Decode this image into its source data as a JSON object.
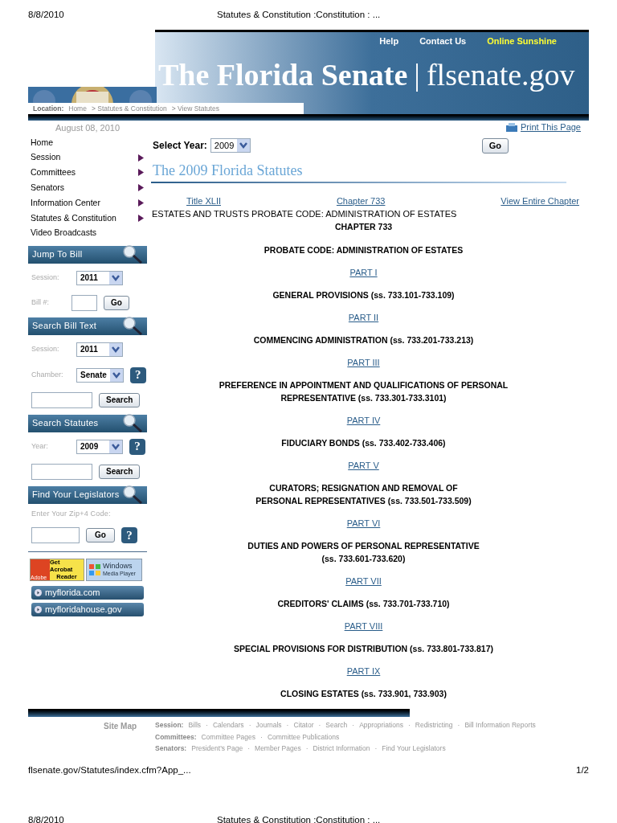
{
  "print_header": {
    "date": "8/8/2010",
    "title": "Statutes & Constitution :Constitution : ..."
  },
  "banner": {
    "nav_links": [
      {
        "label": "Help",
        "highlight": false
      },
      {
        "label": "Contact Us",
        "highlight": false
      },
      {
        "label": "Online Sunshine",
        "highlight": true
      }
    ],
    "title": "The Florida Senate",
    "separator": "|",
    "domain": "flsenate.gov",
    "location": {
      "label": "Location:",
      "crumbs": [
        "Home",
        "> Statutes & Constitution",
        "> View Statutes"
      ]
    }
  },
  "date": "August 08, 2010",
  "print_link": "Print This Page",
  "sidebar": {
    "menu": [
      {
        "label": "Home",
        "has_submenu": false
      },
      {
        "label": "Session",
        "has_submenu": true
      },
      {
        "label": "Committees",
        "has_submenu": true
      },
      {
        "label": "Senators",
        "has_submenu": true
      },
      {
        "label": "Information Center",
        "has_submenu": true
      },
      {
        "label": "Statutes & Constitution",
        "has_submenu": true
      },
      {
        "label": "Video Broadcasts",
        "has_submenu": false
      }
    ],
    "widgets": [
      {
        "title": "Jump To Bill",
        "rows": [
          {
            "kind": "select",
            "label": "Session:",
            "value": "2011"
          },
          {
            "kind": "input",
            "label": "Bill #:",
            "button": "Go"
          }
        ]
      },
      {
        "title": "Search Bill Text",
        "rows": [
          {
            "kind": "select",
            "label": "Session:",
            "value": "2011"
          },
          {
            "kind": "select",
            "label": "Chamber:",
            "value": "Senate",
            "help": "?"
          },
          {
            "kind": "input",
            "button": "Search"
          }
        ]
      },
      {
        "title": "Search Statutes",
        "rows": [
          {
            "kind": "select",
            "label": "Year:",
            "value": "2009",
            "help": "?"
          },
          {
            "kind": "input",
            "button": "Search"
          }
        ]
      },
      {
        "title": "Find Your Legislators",
        "rows": [
          {
            "kind": "note",
            "label": "Enter Your Zip+4 Code:"
          },
          {
            "kind": "input",
            "button": "Go",
            "help": "?"
          }
        ]
      }
    ],
    "badges": {
      "acrobat": {
        "brand": "Adobe",
        "lines": [
          "Get Acrobat",
          "Reader"
        ]
      },
      "media": {
        "lines": [
          "Windows",
          "Media Player"
        ]
      }
    },
    "links": [
      "myflorida.com",
      "myfloridahouse.gov"
    ]
  },
  "main": {
    "select_year": {
      "label": "Select Year:",
      "value": "2009",
      "button": "Go"
    },
    "heading": "The 2009 Florida Statutes",
    "nav": [
      "Title XLII",
      "Chapter 733",
      "View Entire Chapter"
    ],
    "title_line": "ESTATES AND TRUSTS PROBATE CODE: ADMINISTRATION OF ESTATES",
    "chapter": "CHAPTER 733",
    "subtitle": "PROBATE CODE: ADMINISTRATION OF ESTATES",
    "parts": [
      {
        "link": "PART I",
        "lines": [
          "GENERAL PROVISIONS (ss. 733.101-733.109)"
        ]
      },
      {
        "link": "PART II",
        "lines": [
          "COMMENCING ADMINISTRATION (ss. 733.201-733.213)"
        ]
      },
      {
        "link": "PART III",
        "lines": [
          "PREFERENCE IN APPOINTMENT AND QUALIFICATIONS OF PERSONAL",
          "REPRESENTATIVE (ss. 733.301-733.3101)"
        ]
      },
      {
        "link": "PART IV",
        "lines": [
          "FIDUCIARY BONDS (ss. 733.402-733.406)"
        ]
      },
      {
        "link": "PART V",
        "lines": [
          "CURATORS; RESIGNATION AND REMOVAL OF",
          "PERSONAL REPRESENTATIVES (ss. 733.501-733.509)"
        ]
      },
      {
        "link": "PART VI",
        "lines": [
          "DUTIES AND POWERS OF PERSONAL REPRESENTATIVE",
          "(ss. 733.601-733.620)"
        ]
      },
      {
        "link": "PART VII",
        "lines": [
          "CREDITORS' CLAIMS (ss. 733.701-733.710)"
        ]
      },
      {
        "link": "PART VIII",
        "lines": [
          "SPECIAL PROVISIONS FOR DISTRIBUTION (ss. 733.801-733.817)"
        ]
      },
      {
        "link": "PART IX",
        "lines": [
          "CLOSING ESTATES (ss. 733.901, 733.903)"
        ]
      }
    ]
  },
  "sitemap": {
    "label": "Site Map",
    "separator": "·",
    "groups": [
      {
        "label": "Session:",
        "links": [
          "Bills",
          "Calendars",
          "Journals",
          "Citator",
          "Search",
          "Appropriations",
          "Redistricting",
          "Bill Information Reports"
        ]
      },
      {
        "label": "Committees:",
        "links": [
          "Committee Pages",
          "Committee Publications"
        ]
      },
      {
        "label": "Senators:",
        "links": [
          "President's Page",
          "Member Pages",
          "District Information",
          "Find Your Legislators"
        ]
      }
    ]
  },
  "print_footer": {
    "url": "flsenate.gov/Statutes/index.cfm?App_...",
    "page": "1/2"
  },
  "next_header": {
    "date": "8/8/2010",
    "title": "Statutes & Constitution :Constitution : ..."
  }
}
